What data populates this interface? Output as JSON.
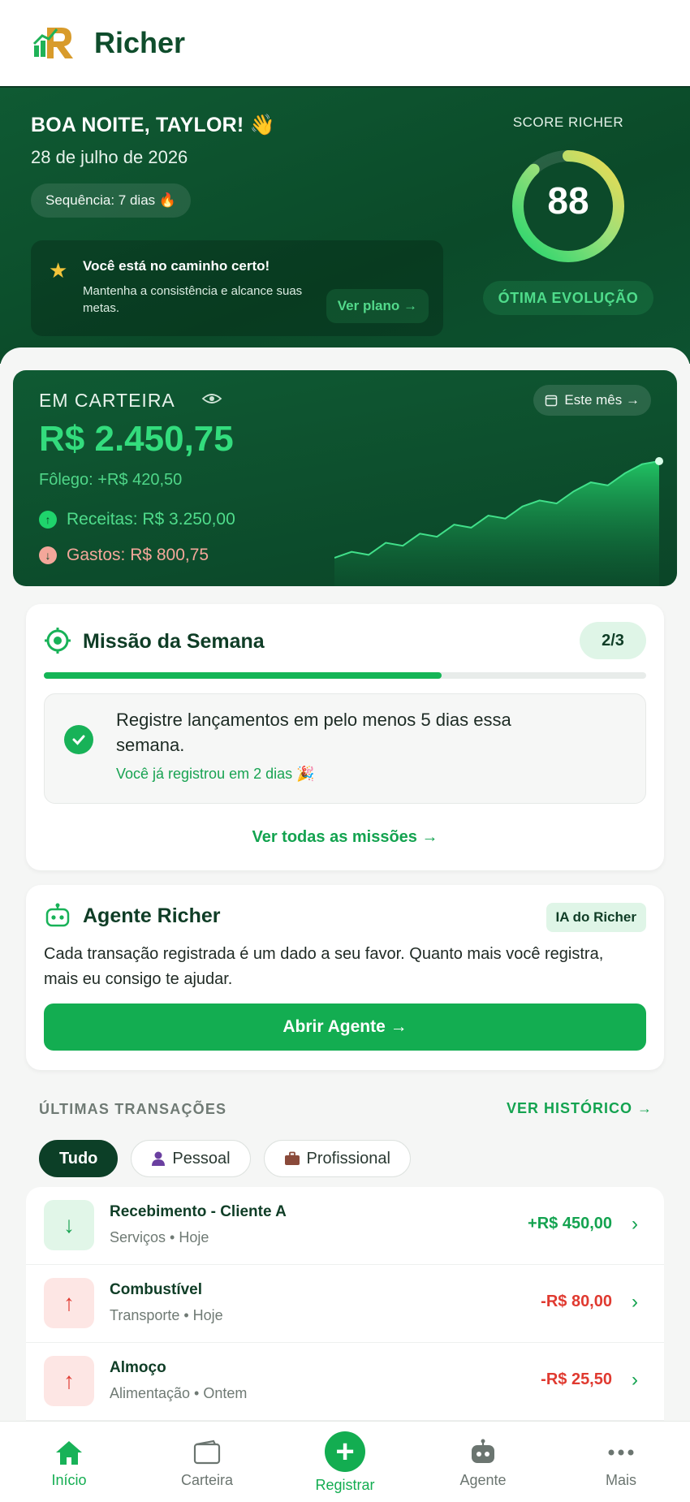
{
  "app": {
    "brand": "Richer"
  },
  "hero": {
    "greeting": "BOA NOITE, TAYLOR! 👋",
    "date": "28 de julho de 2026",
    "streak": "Sequência: 7 dias 🔥",
    "tip": {
      "title": "Você está no caminho certo!",
      "body": "Mantenha a consistência e alcance suas metas.",
      "button": "Ver plano →"
    },
    "score": {
      "label": "SCORE RICHER",
      "value": "88",
      "level": 0.88,
      "tag": "ÓTIMA EVOLUÇÃO"
    }
  },
  "wallet": {
    "label": "EM CARTEIRA",
    "period": "Este mês →",
    "amount": "R$ 2.450,75",
    "folego": "Fôlego: +R$ 420,50",
    "income": "Receitas: R$ 3.250,00",
    "expense": "Gastos: R$ 800,75",
    "trend": [
      8,
      12,
      10,
      18,
      16,
      24,
      22,
      30,
      28,
      36,
      34,
      42,
      46,
      44,
      52,
      58,
      56,
      64,
      70,
      72
    ]
  },
  "mission": {
    "title": "Missão da Semana",
    "badge": "2/3",
    "progress": 0.66,
    "task": "Registre lançamentos em pelo menos 5 dias essa semana.",
    "task_sub": "Você já registrou em 2 dias 🎉",
    "link": "Ver todas as missões →"
  },
  "agent": {
    "title": "Agente Richer",
    "badge": "IA do Richer",
    "text": "Cada transação registrada é um dado a seu favor. Quanto mais você registra, mais eu consigo te ajudar.",
    "button": "Abrir Agente →"
  },
  "transactions": {
    "title": "ÚLTIMAS TRANSAÇÕES",
    "link": "VER HISTÓRICO →",
    "filters": [
      "Tudo",
      "Pessoal",
      "Profissional"
    ],
    "items": [
      {
        "name": "Recebimento - Cliente A",
        "meta": "Serviços • Hoje",
        "amount": "+R$ 450,00"
      },
      {
        "name": "Combustível",
        "meta": "Transporte • Hoje",
        "amount": "-R$ 80,00"
      },
      {
        "name": "Almoço",
        "meta": "Alimentação • Ontem",
        "amount": "-R$ 25,50"
      }
    ]
  },
  "nav": [
    "Início",
    "Carteira",
    "Registrar",
    "Agente",
    "Mais"
  ],
  "colors": {
    "primary": "#13ad51",
    "dark_green": "#0b4a29",
    "income": "#14a350",
    "expense": "#e03a30",
    "score_yellow": "#f2d94e"
  }
}
